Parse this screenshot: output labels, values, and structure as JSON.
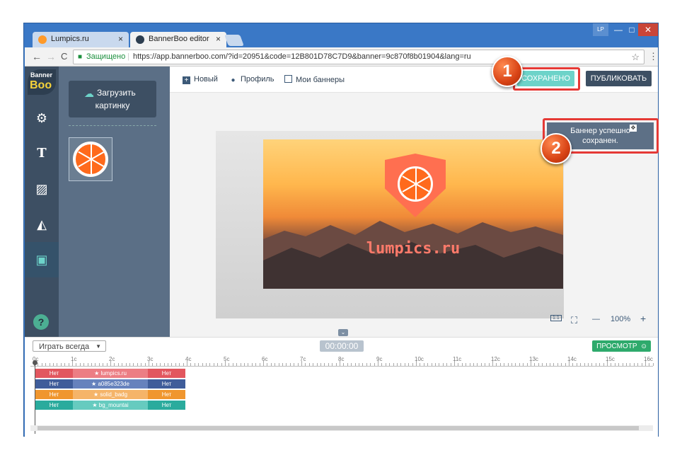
{
  "browser": {
    "tabs": [
      {
        "title": "Lumpics.ru",
        "close": "×"
      },
      {
        "title": "BannerBoo editor",
        "close": "×"
      }
    ],
    "user_badge": "LP",
    "window_controls": {
      "minimize": "—",
      "maximize": "□",
      "close": "✕"
    },
    "nav": {
      "back": "←",
      "forward": "→",
      "reload": "C"
    },
    "secure_label": "Защищено",
    "url": "https://app.bannerboo.com/?id=20951&code=12B801D78C7D9&banner=9c870f8b01904&lang=ru",
    "star": "☆",
    "menu": "⋮"
  },
  "sidebar": {
    "logo_top": "Banner",
    "logo_bottom": "Boo",
    "help": "?"
  },
  "panel": {
    "upload_line1": "Загрузить",
    "upload_line2": "картинку"
  },
  "toolbar": {
    "new_label": "Новый",
    "profile_label": "Профиль",
    "my_banners_label": "Мои баннеры",
    "saved_label": "СОХРАНЕНО",
    "publish_label": "ПУБЛИКОВАТЬ"
  },
  "toast": {
    "line1": "Баннер успешно",
    "line2": "сохранен."
  },
  "annotations": {
    "badge1": "1",
    "badge2": "2"
  },
  "canvas": {
    "banner_text": "lumpics.ru",
    "zoom": "100%",
    "zoom_minus": "—",
    "zoom_plus": "+",
    "ratio": "1:1"
  },
  "timeline": {
    "loop_select": "Играть всегда",
    "time": "00:00:00",
    "preview_label": "ПРОСМОТР",
    "ruler": [
      "0c",
      "1c",
      "2c",
      "3c",
      "4c",
      "5c",
      "6c",
      "7c",
      "8c",
      "9c",
      "10c",
      "11c",
      "12c",
      "13c",
      "14c",
      "15c",
      "16c"
    ],
    "tracks": [
      {
        "left": "Нет",
        "name": "lumpics.ru",
        "right": "Нет",
        "color": "#e2575f",
        "mid": "#ec7e84"
      },
      {
        "left": "Нет",
        "name": "a085e323de",
        "right": "Нет",
        "color": "#3f5d9a",
        "mid": "#6682bd"
      },
      {
        "left": "Нет",
        "name": "solid_badg",
        "right": "Нет",
        "color": "#f0962e",
        "mid": "#f5b469"
      },
      {
        "left": "Нет",
        "name": "bg_mountai",
        "right": "Нет",
        "color": "#2aab9d",
        "mid": "#66cbbf"
      }
    ]
  }
}
